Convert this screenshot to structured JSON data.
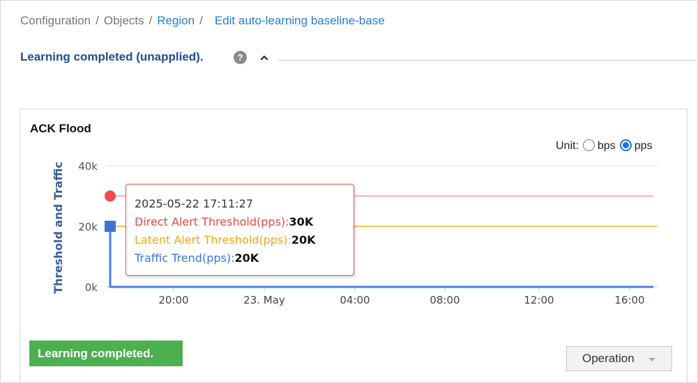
{
  "breadcrumb": {
    "items": [
      "Configuration",
      "Objects",
      "Region"
    ],
    "separator": "/",
    "current": "Edit auto-learning baseline-base"
  },
  "section": {
    "title": "Learning completed (unapplied).",
    "help_icon": "question-circle-icon",
    "collapse_icon": "chevron-up-icon"
  },
  "chart": {
    "title": "ACK Flood",
    "unit_label": "Unit:",
    "unit_options": [
      "bps",
      "pps"
    ],
    "unit_selected": "pps"
  },
  "chart_data": {
    "type": "line",
    "ylabel": "Threshold and Traffic",
    "ylim": [
      0,
      40000
    ],
    "yticks": [
      "0k",
      "20k",
      "40k"
    ],
    "xticks": [
      "20:00",
      "23. May",
      "04:00",
      "08:00",
      "12:00",
      "16:00"
    ],
    "series": [
      {
        "name": "Direct Alert Threshold(pps)",
        "color": "#f04b4b",
        "value": 30000
      },
      {
        "name": "Latent Alert Threshold(pps)",
        "color": "#e6b422",
        "value": 20000
      },
      {
        "name": "Traffic Trend(pps)",
        "color": "#4a7fd8",
        "value_start": 20000,
        "value_rest": 0
      }
    ]
  },
  "tooltip": {
    "timestamp": "2025-05-22 17:11:27",
    "direct_label": "Direct Alert Threshold(pps):",
    "direct_value": "30K",
    "latent_label": "Latent Alert Threshold(pps):",
    "latent_value": "20K",
    "traffic_label": "Traffic Trend(pps):",
    "traffic_value": "20K"
  },
  "status_badge": "Learning completed.",
  "operation_button": "Operation"
}
